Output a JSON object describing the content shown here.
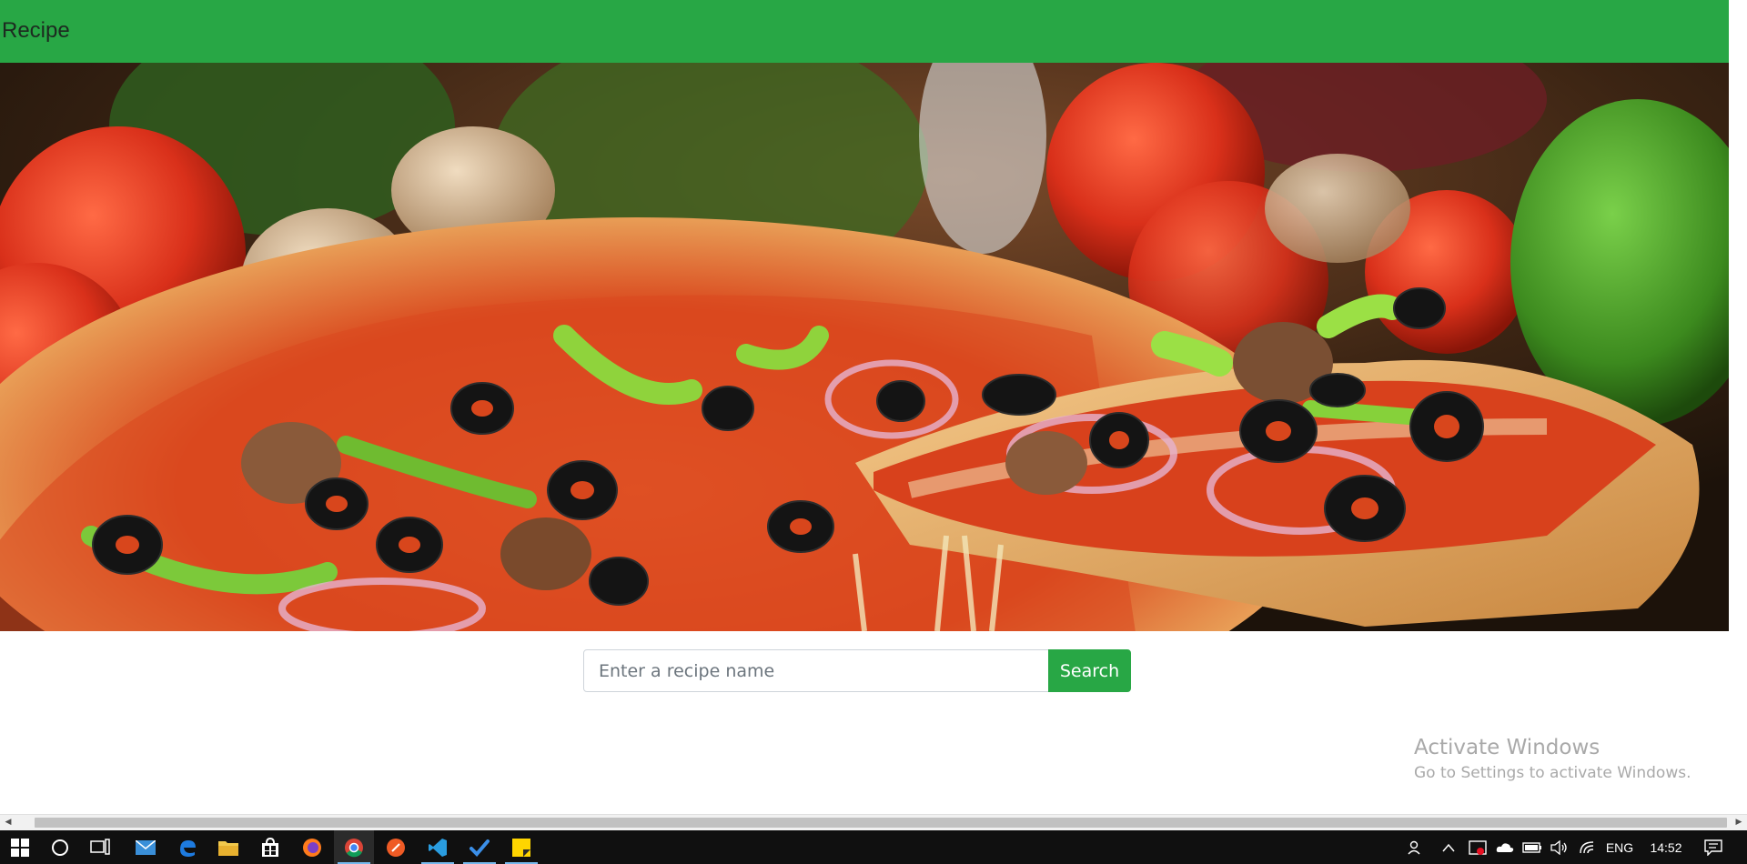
{
  "navbar": {
    "brand": "Recipe",
    "color": "#28a745"
  },
  "hero": {
    "image": "pizza-hero-image"
  },
  "search": {
    "placeholder": "Enter a recipe name",
    "value": "",
    "button_label": "Search"
  },
  "watermark": {
    "title": "Activate Windows",
    "subtitle": "Go to Settings to activate Windows."
  },
  "scrollbar": {
    "left_arrow": "◀",
    "right_arrow": "▶"
  },
  "taskbar": {
    "apps": [
      {
        "name": "start-icon"
      },
      {
        "name": "cortana-icon"
      },
      {
        "name": "task-view-icon"
      },
      {
        "name": "mail-icon"
      },
      {
        "name": "edge-icon"
      },
      {
        "name": "file-explorer-icon"
      },
      {
        "name": "store-icon"
      },
      {
        "name": "firefox-icon"
      },
      {
        "name": "chrome-icon"
      },
      {
        "name": "postman-icon"
      },
      {
        "name": "vscode-icon"
      },
      {
        "name": "todo-icon"
      },
      {
        "name": "sticky-notes-icon"
      }
    ],
    "tray": {
      "language": "ENG",
      "time": "14:52"
    }
  }
}
